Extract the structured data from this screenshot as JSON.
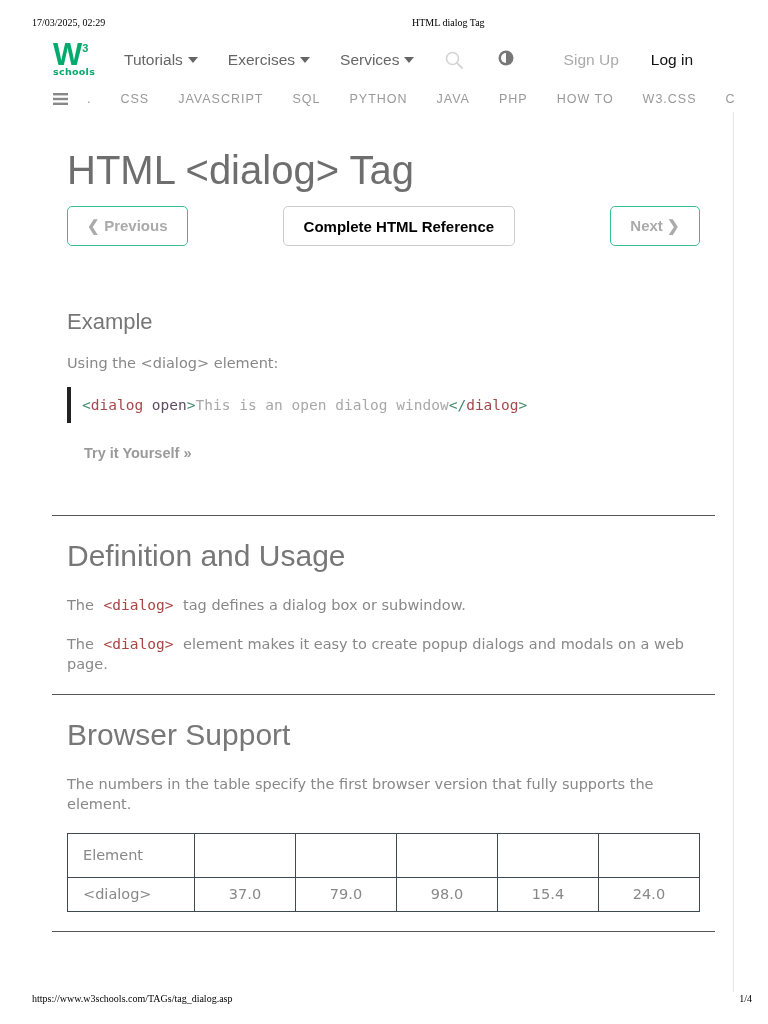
{
  "print_header": {
    "date": "17/03/2025, 02:29",
    "title": "HTML dialog Tag"
  },
  "navbar": {
    "logo": {
      "letter": "W",
      "superscript": "3",
      "word": "schools"
    },
    "menus": [
      "Tutorials",
      "Exercises",
      "Services"
    ],
    "sign_up": "Sign Up",
    "log_in": "Log in"
  },
  "topics": [
    ".",
    "CSS",
    "JAVASCRIPT",
    "SQL",
    "PYTHON",
    "JAVA",
    "PHP",
    "HOW TO",
    "W3.CSS",
    "C"
  ],
  "title": "HTML <dialog> Tag",
  "buttons": [
    {
      "kind": "previous",
      "label": "❮ Previous"
    },
    {
      "kind": "reference",
      "label": "Complete HTML Reference"
    },
    {
      "kind": "next",
      "label": "Next ❯"
    }
  ],
  "example": {
    "heading": "Example",
    "intro": "Using the <dialog> element:",
    "code": [
      {
        "kind": "bracket",
        "text": "<"
      },
      {
        "kind": "tag",
        "text": "dialog"
      },
      {
        "kind": "attr",
        "text": " open"
      },
      {
        "kind": "bracket",
        "text": ">"
      },
      {
        "kind": "text",
        "text": "This is an open dialog window"
      },
      {
        "kind": "bracket",
        "text": "</"
      },
      {
        "kind": "tag",
        "text": "dialog"
      },
      {
        "kind": "bracket",
        "text": ">"
      }
    ],
    "try_it": "Try it Yourself »"
  },
  "sections": [
    {
      "heading": "Definition and Usage",
      "paragraphs": [
        [
          {
            "kind": "text",
            "text": "The "
          },
          {
            "kind": "code",
            "text": "<dialog>"
          },
          {
            "kind": "text",
            "text": " tag defines a dialog box or subwindow."
          }
        ],
        [
          {
            "kind": "text",
            "text": "The "
          },
          {
            "kind": "code",
            "text": "<dialog>"
          },
          {
            "kind": "text",
            "text": " element makes it easy to create popup dialogs and modals on a web page."
          }
        ]
      ]
    },
    {
      "heading": "Browser Support",
      "paragraphs": [
        [
          {
            "kind": "text",
            "text": "The numbers in the table specify the first browser version that fully supports the element."
          }
        ]
      ],
      "table": {
        "header": [
          "Element"
        ],
        "rows": [
          [
            "<dialog>",
            "37.0",
            "79.0",
            "98.0",
            "15.4",
            "24.0"
          ]
        ]
      }
    }
  ],
  "print_footer": {
    "url": "https://www.w3schools.com/TAGs/tag_dialog.asp",
    "page": "1/4"
  }
}
